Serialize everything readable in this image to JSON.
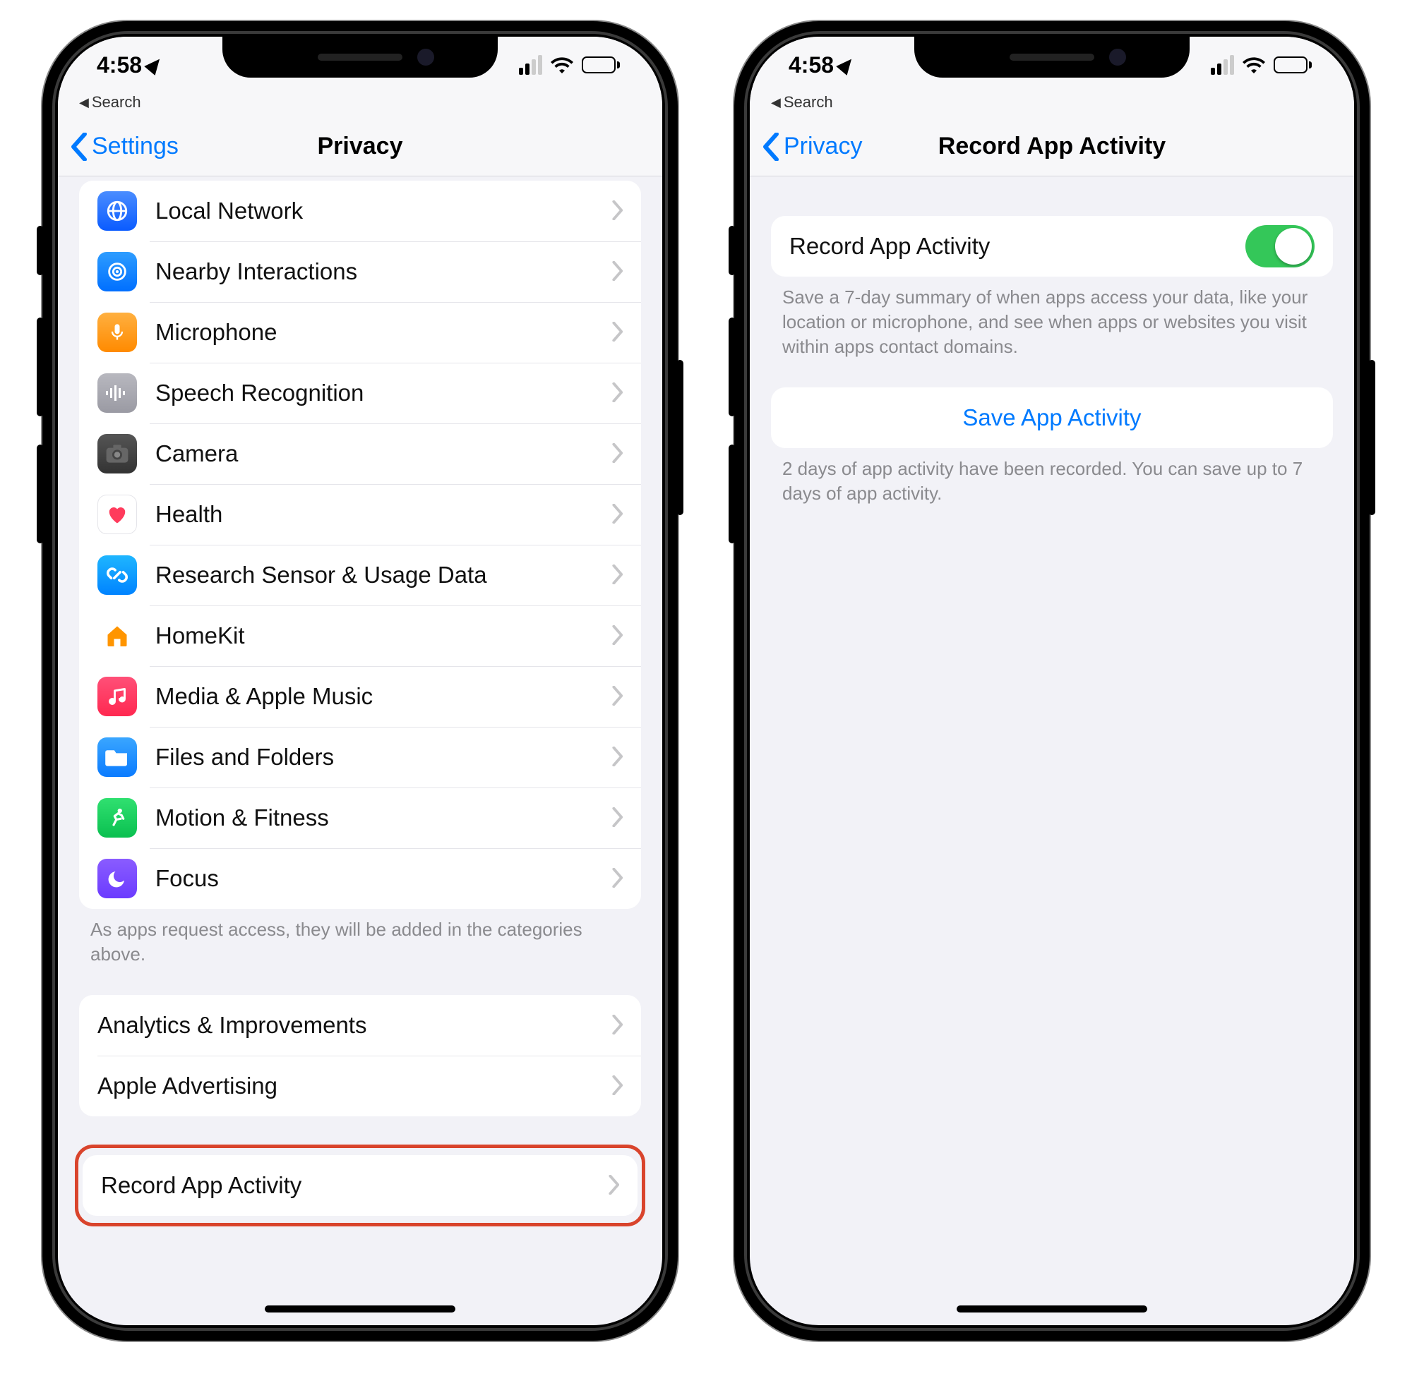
{
  "scale": "2000x1967",
  "phoneA": {
    "status": {
      "time": "4:58",
      "crumb": "Search"
    },
    "nav": {
      "back": "Settings",
      "title": "Privacy"
    },
    "items": [
      {
        "id": "local-network",
        "label": "Local Network",
        "iconCls": "ic-blue",
        "glyph": "globe"
      },
      {
        "id": "nearby",
        "label": "Nearby Interactions",
        "iconCls": "ic-bright-blue",
        "glyph": "target"
      },
      {
        "id": "microphone",
        "label": "Microphone",
        "iconCls": "ic-orange",
        "glyph": "mic"
      },
      {
        "id": "speech",
        "label": "Speech Recognition",
        "iconCls": "ic-gray",
        "glyph": "wave"
      },
      {
        "id": "camera",
        "label": "Camera",
        "iconCls": "ic-dark",
        "glyph": "camera"
      },
      {
        "id": "health",
        "label": "Health",
        "iconCls": "ic-white",
        "glyph": "heart"
      },
      {
        "id": "research",
        "label": "Research Sensor & Usage Data",
        "iconCls": "ic-brightblue2",
        "glyph": "chain"
      },
      {
        "id": "homekit",
        "label": "HomeKit",
        "iconCls": "ic-home",
        "glyph": "house"
      },
      {
        "id": "media",
        "label": "Media & Apple Music",
        "iconCls": "ic-pink",
        "glyph": "music"
      },
      {
        "id": "files",
        "label": "Files and Folders",
        "iconCls": "ic-topblue",
        "glyph": "folder"
      },
      {
        "id": "motion",
        "label": "Motion & Fitness",
        "iconCls": "ic-green",
        "glyph": "runner"
      },
      {
        "id": "focus",
        "label": "Focus",
        "iconCls": "ic-purple",
        "glyph": "moon"
      }
    ],
    "itemsFooter": "As apps request access, they will be added in the categories above.",
    "group2": [
      {
        "id": "analytics",
        "label": "Analytics & Improvements"
      },
      {
        "id": "adv",
        "label": "Apple Advertising"
      }
    ],
    "group3": [
      {
        "id": "record",
        "label": "Record App Activity"
      }
    ]
  },
  "phoneB": {
    "status": {
      "time": "4:58",
      "crumb": "Search"
    },
    "nav": {
      "back": "Privacy",
      "title": "Record App Activity"
    },
    "toggle": {
      "label": "Record App Activity",
      "on": true
    },
    "toggleFooter": "Save a 7-day summary of when apps access your data, like your location or microphone, and see when apps or websites you visit within apps contact domains.",
    "save": {
      "label": "Save App Activity"
    },
    "saveFooter": "2 days of app activity have been recorded. You can save up to 7 days of app activity."
  }
}
